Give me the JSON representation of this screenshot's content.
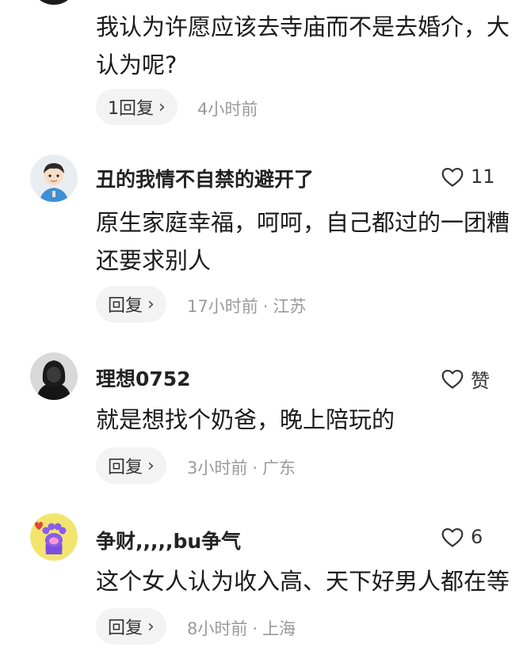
{
  "top_comment": {
    "text_lines": [
      "我认为许愿应该去寺庙而不是去婚介，大",
      "认为呢?"
    ],
    "reply_label": "1回复",
    "time": "4小时前",
    "location": ""
  },
  "comments": [
    {
      "username": "丑的我情不自禁的避开了",
      "likes": "11",
      "text_lines": [
        "原生家庭幸福，呵呵，自己都过的一团糟",
        "还要求别人"
      ],
      "reply_label": "回复",
      "time": "17小时前",
      "location": "江苏"
    },
    {
      "username": "理想0752",
      "likes": "赞",
      "text_lines": [
        "就是想找个奶爸，晚上陪玩的"
      ],
      "reply_label": "回复",
      "time": "3小时前",
      "location": "广东"
    },
    {
      "username": "争财,,,,,bu争气",
      "likes": "6",
      "text_lines": [
        "这个女人认为收入高、天下好男人都在等"
      ],
      "reply_label": "回复",
      "time": "8小时前",
      "location": "上海"
    }
  ],
  "icons": {
    "like": "heart-outline-icon",
    "chevron": "chevron-right-icon"
  },
  "colors": {
    "reply_bg": "#f3f3f3",
    "meta_text": "#9a9a9a"
  }
}
